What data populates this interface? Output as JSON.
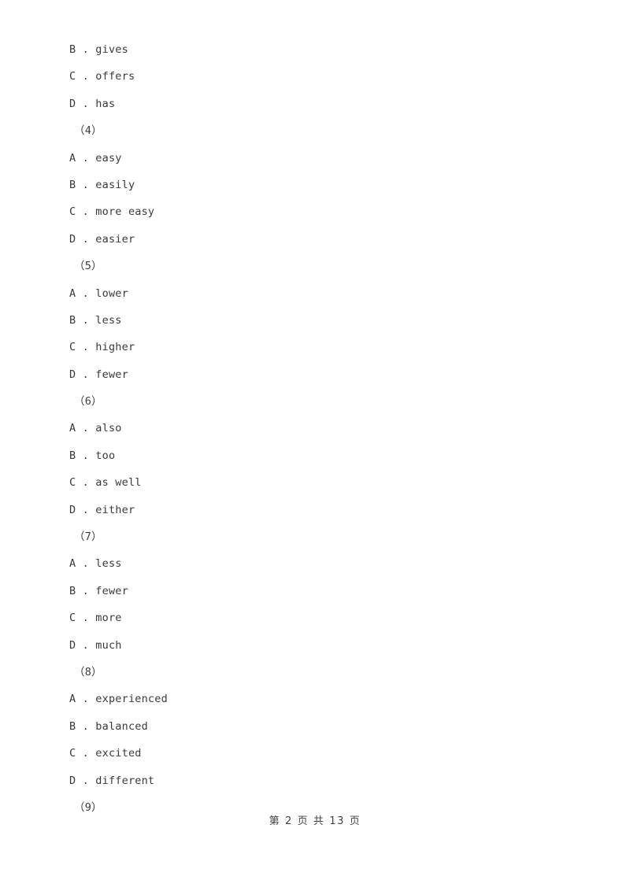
{
  "document": {
    "page_label": "第 2 页 共 13 页",
    "page_number": "2",
    "total_pages": "13",
    "text_color": "#3a3a3a",
    "background_color": "#ffffff"
  },
  "lines": [
    {
      "kind": "option",
      "text": "B . gives"
    },
    {
      "kind": "option",
      "text": "C . offers"
    },
    {
      "kind": "option",
      "text": "D . has"
    },
    {
      "kind": "qnum",
      "text": "（4）"
    },
    {
      "kind": "option",
      "text": "A . easy"
    },
    {
      "kind": "option",
      "text": "B . easily"
    },
    {
      "kind": "option",
      "text": "C . more easy"
    },
    {
      "kind": "option",
      "text": "D . easier"
    },
    {
      "kind": "qnum",
      "text": "（5）"
    },
    {
      "kind": "option",
      "text": "A . lower"
    },
    {
      "kind": "option",
      "text": "B . less"
    },
    {
      "kind": "option",
      "text": "C . higher"
    },
    {
      "kind": "option",
      "text": "D . fewer"
    },
    {
      "kind": "qnum",
      "text": "（6）"
    },
    {
      "kind": "option",
      "text": "A . also"
    },
    {
      "kind": "option",
      "text": "B . too"
    },
    {
      "kind": "option",
      "text": "C . as well"
    },
    {
      "kind": "option",
      "text": "D . either"
    },
    {
      "kind": "qnum",
      "text": "（7）"
    },
    {
      "kind": "option",
      "text": "A . less"
    },
    {
      "kind": "option",
      "text": "B . fewer"
    },
    {
      "kind": "option",
      "text": "C . more"
    },
    {
      "kind": "option",
      "text": "D . much"
    },
    {
      "kind": "qnum",
      "text": "（8）"
    },
    {
      "kind": "option",
      "text": "A . experienced"
    },
    {
      "kind": "option",
      "text": "B . balanced"
    },
    {
      "kind": "option",
      "text": "C . excited"
    },
    {
      "kind": "option",
      "text": "D . different"
    },
    {
      "kind": "qnum",
      "text": "（9）"
    }
  ]
}
